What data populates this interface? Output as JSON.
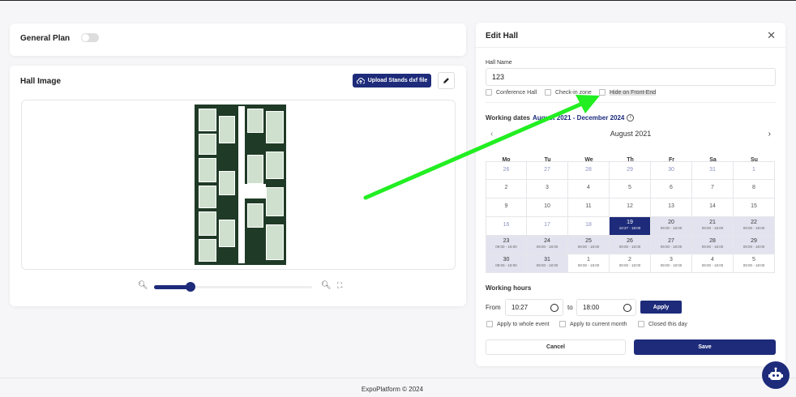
{
  "general_plan": {
    "title": "General Plan"
  },
  "hall_image": {
    "title": "Hall Image",
    "upload_label": "Upload Stands dxf file"
  },
  "edit_hall": {
    "title": "Edit Hall",
    "hall_name_label": "Hall Name",
    "hall_name_value": "123",
    "checkboxes": [
      "Conference Hall",
      "Check-in zone",
      "Hide on Front-End"
    ],
    "working_dates_label": "Working dates",
    "working_dates_range": "August 2021 - December 2024",
    "month": "August 2021",
    "weekdays": [
      "Mo",
      "Tu",
      "We",
      "Th",
      "Fr",
      "Sa",
      "Su"
    ],
    "days": [
      {
        "d": "26",
        "s": "out"
      },
      {
        "d": "27",
        "s": "out"
      },
      {
        "d": "28",
        "s": "out"
      },
      {
        "d": "29",
        "s": "out"
      },
      {
        "d": "30",
        "s": "out"
      },
      {
        "d": "31",
        "s": "out"
      },
      {
        "d": "1",
        "s": "out"
      },
      {
        "d": "2",
        "s": "past"
      },
      {
        "d": "3",
        "s": "past"
      },
      {
        "d": "4",
        "s": "past"
      },
      {
        "d": "5",
        "s": "past"
      },
      {
        "d": "6",
        "s": "past"
      },
      {
        "d": "7",
        "s": "past"
      },
      {
        "d": "8",
        "s": "past"
      },
      {
        "d": "9",
        "s": "past"
      },
      {
        "d": "10",
        "s": "past"
      },
      {
        "d": "11",
        "s": "past"
      },
      {
        "d": "12",
        "s": "past"
      },
      {
        "d": "13",
        "s": "past"
      },
      {
        "d": "14",
        "s": "past"
      },
      {
        "d": "15",
        "s": "past"
      },
      {
        "d": "16",
        "s": "out"
      },
      {
        "d": "17",
        "s": "out"
      },
      {
        "d": "18",
        "s": "out"
      },
      {
        "d": "19",
        "s": "sel",
        "t": "10:27 - 18:00"
      },
      {
        "d": "20",
        "s": "avail",
        "t": "09:00 - 18:00"
      },
      {
        "d": "21",
        "s": "avail",
        "t": "09:00 - 18:00"
      },
      {
        "d": "22",
        "s": "avail",
        "t": "09:00 - 18:00"
      },
      {
        "d": "23",
        "s": "avail",
        "t": "09:00 - 18:00"
      },
      {
        "d": "24",
        "s": "avail",
        "t": "09:00 - 18:00"
      },
      {
        "d": "25",
        "s": "avail",
        "t": "09:00 - 18:00"
      },
      {
        "d": "26",
        "s": "avail",
        "t": "09:00 - 18:00"
      },
      {
        "d": "27",
        "s": "avail",
        "t": "09:00 - 18:00"
      },
      {
        "d": "28",
        "s": "avail",
        "t": "09:00 - 18:00"
      },
      {
        "d": "29",
        "s": "avail",
        "t": "09:00 - 18:00"
      },
      {
        "d": "30",
        "s": "avail",
        "t": "09:00 - 18:00"
      },
      {
        "d": "31",
        "s": "avail",
        "t": "09:00 - 18:00"
      },
      {
        "d": "1",
        "s": "next",
        "t": "09:00 - 18:00"
      },
      {
        "d": "2",
        "s": "next",
        "t": "09:00 - 18:00"
      },
      {
        "d": "3",
        "s": "next",
        "t": "09:00 - 18:00"
      },
      {
        "d": "4",
        "s": "next",
        "t": "09:00 - 18:00"
      },
      {
        "d": "5",
        "s": "next",
        "t": "09:00 - 18:00"
      }
    ],
    "working_hours_label": "Working hours",
    "from_label": "From",
    "from_value": "10:27",
    "to_label": "to",
    "to_value": "18:00",
    "apply_label": "Apply",
    "apply_options": [
      "Apply to whole event",
      "Apply to current month",
      "Closed this day"
    ],
    "cancel_label": "Cancel",
    "save_label": "Save"
  },
  "footer": {
    "text": "ExpoPlatform © 2024"
  },
  "colors": {
    "accent": "#1d2b7a",
    "arrow": "#22ee22"
  },
  "zoom_level": 0.23
}
